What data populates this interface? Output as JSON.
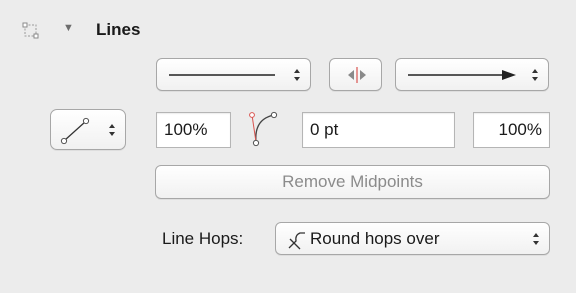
{
  "section": {
    "title": "Lines",
    "expanded": true
  },
  "icons": {
    "header": "line-tool-icon",
    "disclosure": "disclosure-triangle-down-icon",
    "line_type": "diagonal-line-icon",
    "bezier": "bezier-curve-icon",
    "swap": "swap-arrows-icon",
    "round_hop": "round-hop-icon",
    "stepper": "stepper-arrows-icon"
  },
  "line_style": {
    "start": "plain line",
    "end": "arrow line"
  },
  "values": {
    "start_scale": "100%",
    "midpoint": "0 pt",
    "end_scale": "100%"
  },
  "buttons": {
    "remove_midpoints": "Remove Midpoints"
  },
  "line_hops": {
    "label": "Line Hops:",
    "selected": "Round hops over"
  },
  "colors": {
    "accent_red": "#d9534f"
  }
}
